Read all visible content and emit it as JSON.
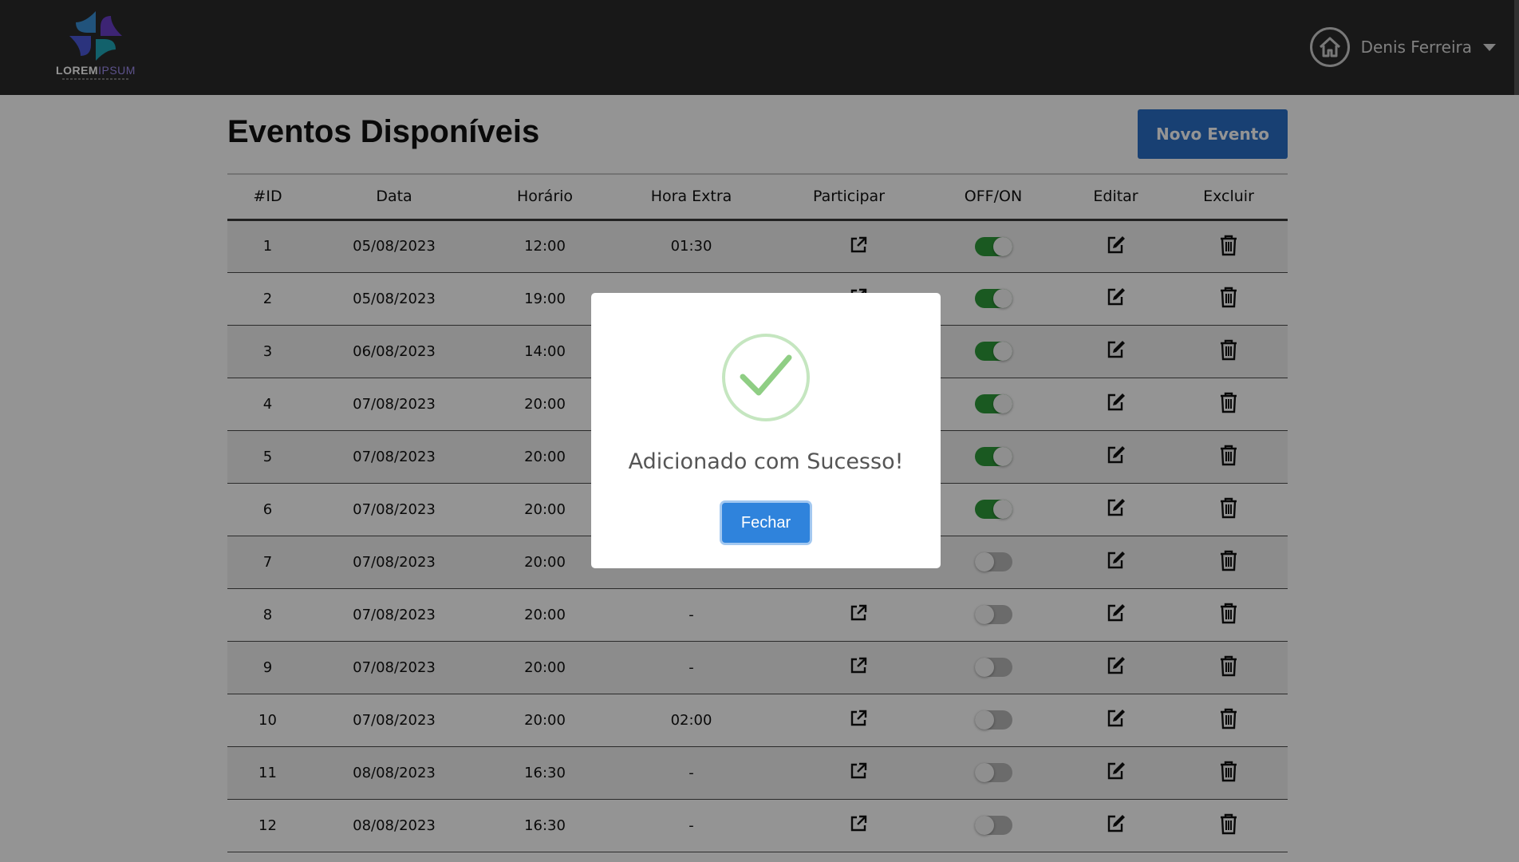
{
  "header": {
    "logo_text_bold": "LOREM",
    "logo_text_light": "IPSUM",
    "user_name": "Denis Ferreira",
    "icons": {
      "home": "home-icon",
      "menu": "caret-down-icon"
    }
  },
  "main": {
    "title": "Eventos Disponíveis",
    "new_event_label": "Novo Evento",
    "table": {
      "columns": [
        "#ID",
        "Data",
        "Horário",
        "Hora Extra",
        "Participar",
        "OFF/ON",
        "Editar",
        "Excluir"
      ],
      "rows": [
        {
          "id": "1",
          "data": "05/08/2023",
          "horario": "12:00",
          "hora_extra": "01:30",
          "on": true
        },
        {
          "id": "2",
          "data": "05/08/2023",
          "horario": "19:00",
          "hora_extra": "",
          "on": true
        },
        {
          "id": "3",
          "data": "06/08/2023",
          "horario": "14:00",
          "hora_extra": "",
          "on": true
        },
        {
          "id": "4",
          "data": "07/08/2023",
          "horario": "20:00",
          "hora_extra": "",
          "on": true
        },
        {
          "id": "5",
          "data": "07/08/2023",
          "horario": "20:00",
          "hora_extra": "",
          "on": true
        },
        {
          "id": "6",
          "data": "07/08/2023",
          "horario": "20:00",
          "hora_extra": "",
          "on": true
        },
        {
          "id": "7",
          "data": "07/08/2023",
          "horario": "20:00",
          "hora_extra": "",
          "on": false
        },
        {
          "id": "8",
          "data": "07/08/2023",
          "horario": "20:00",
          "hora_extra": "-",
          "on": false
        },
        {
          "id": "9",
          "data": "07/08/2023",
          "horario": "20:00",
          "hora_extra": "-",
          "on": false
        },
        {
          "id": "10",
          "data": "07/08/2023",
          "horario": "20:00",
          "hora_extra": "02:00",
          "on": false
        },
        {
          "id": "11",
          "data": "08/08/2023",
          "horario": "16:30",
          "hora_extra": "-",
          "on": false
        },
        {
          "id": "12",
          "data": "08/08/2023",
          "horario": "16:30",
          "hora_extra": "-",
          "on": false
        }
      ],
      "icons": {
        "participar": "external-link-icon",
        "editar": "edit-icon",
        "excluir": "trash-icon"
      }
    }
  },
  "modal": {
    "message": "Adicionado com Sucesso!",
    "close_label": "Fechar",
    "icon": "success-check-icon"
  },
  "colors": {
    "topbar": "#2a2a2a",
    "primary_button": "#2a6fc6",
    "toggle_on": "#2e9a39",
    "success_ring": "#c5e6c0",
    "success_check": "#8fce84"
  }
}
